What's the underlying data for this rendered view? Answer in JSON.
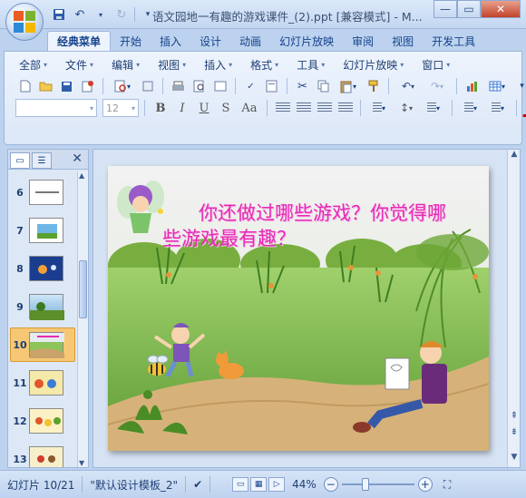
{
  "app": {
    "window_title": "语文园地一有趣的游戏课件_(2).ppt [兼容模式] - M...",
    "quick_access": [
      "save-icon",
      "undo-icon",
      "redo-icon",
      "customize-icon"
    ]
  },
  "ribbon_tabs": [
    {
      "label": "经典菜单",
      "active": true
    },
    {
      "label": "开始"
    },
    {
      "label": "插入"
    },
    {
      "label": "设计"
    },
    {
      "label": "动画"
    },
    {
      "label": "幻灯片放映"
    },
    {
      "label": "审阅"
    },
    {
      "label": "视图"
    },
    {
      "label": "开发工具"
    }
  ],
  "classic_menu": [
    "全部",
    "文件",
    "编辑",
    "视图",
    "插入",
    "格式",
    "工具",
    "幻灯片放映",
    "窗口"
  ],
  "font": {
    "font_name_value": "",
    "font_size_value": "12",
    "bold": "B",
    "italic": "I",
    "underline": "U",
    "strike": "S",
    "change_case": "Aa"
  },
  "slides_pane": {
    "thumbnails": [
      {
        "num": "6"
      },
      {
        "num": "7"
      },
      {
        "num": "8"
      },
      {
        "num": "9"
      },
      {
        "num": "10",
        "selected": true
      },
      {
        "num": "11"
      },
      {
        "num": "12"
      },
      {
        "num": "13"
      }
    ]
  },
  "slide": {
    "text": "你还做过哪些游戏？你觉得哪些游戏最有趣？"
  },
  "status": {
    "slide_info": "幻灯片 10/21",
    "theme": "\"默认设计模板_2\"",
    "zoom": "44%"
  },
  "colors": {
    "slide_text": "#e62ab4",
    "selected_thumb": "#f6c774"
  }
}
